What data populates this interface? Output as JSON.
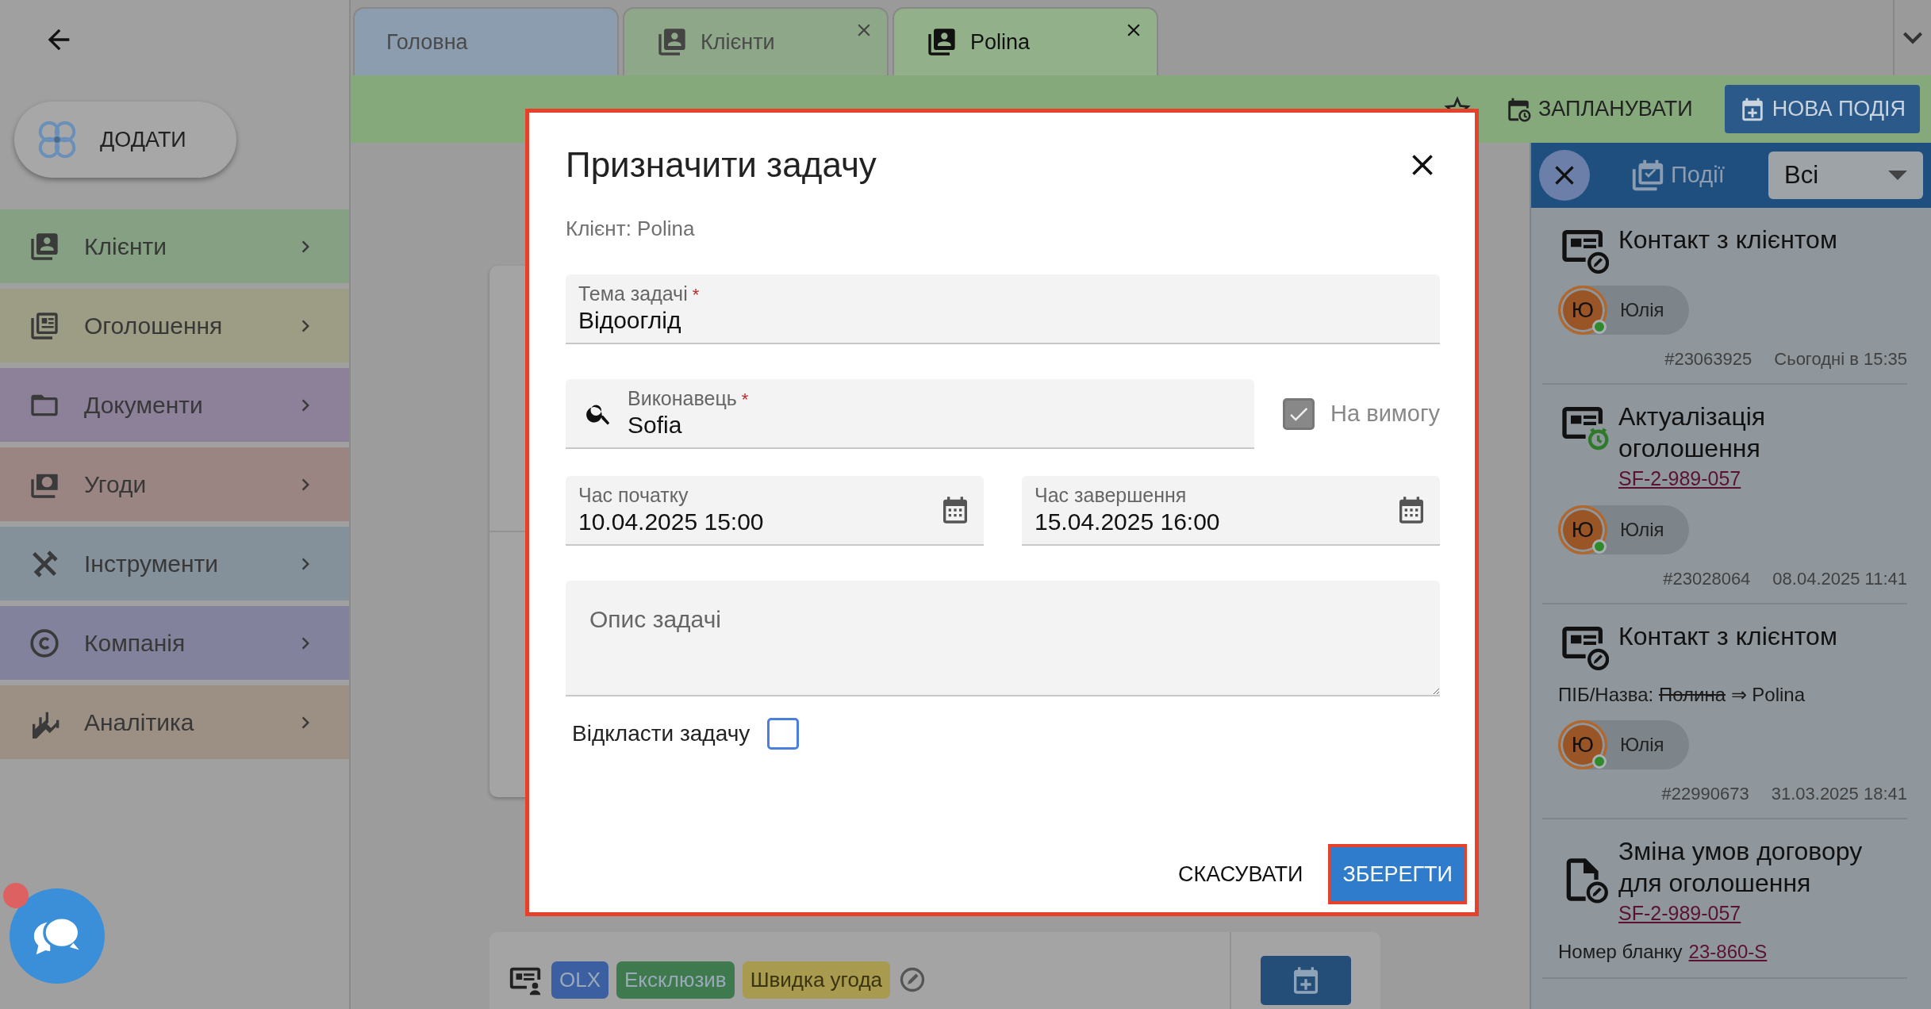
{
  "add_button": {
    "label": "ДОДАТИ"
  },
  "sidebar": {
    "items": [
      {
        "label": "Клієнти",
        "color": "#86a083"
      },
      {
        "label": "Оголошення",
        "color": "#9d9d85"
      },
      {
        "label": "Документи",
        "color": "#8c8199"
      },
      {
        "label": "Угоди",
        "color": "#9a8582"
      },
      {
        "label": "Інструменти",
        "color": "#84919b"
      },
      {
        "label": "Компанія",
        "color": "#82829c"
      },
      {
        "label": "Аналітика",
        "color": "#9c8f84"
      }
    ]
  },
  "tabs": [
    {
      "label": "Головна",
      "selected": false,
      "closable": false
    },
    {
      "label": "Клієнти",
      "selected": false,
      "closable": true
    },
    {
      "label": "Polina",
      "selected": true,
      "closable": true
    }
  ],
  "toolbar": {
    "actions": [
      {
        "label": "ЗАПЛАНУВАТИ",
        "kind": "plain"
      },
      {
        "label": "НОВА ПОДІЯ",
        "kind": "primary"
      }
    ]
  },
  "background_card": {
    "tags": [
      {
        "label": "OLX",
        "color": "#3b5fa0"
      },
      {
        "label": "Ексклюзив",
        "color": "#3e7a4e"
      },
      {
        "label": "Швидка угода",
        "color": "#a89a4e"
      }
    ]
  },
  "events_panel": {
    "title": "Події",
    "filter": "Всі",
    "events": [
      {
        "kind": "contact",
        "title": "Контакт з клієнтом",
        "user": {
          "initial": "Ю",
          "name": "Юлія"
        },
        "id": "#23063925",
        "time": "Сьогодні в 15:35"
      },
      {
        "kind": "reminder",
        "title": "Актуалізація оголошення",
        "link": "SF-2-989-057",
        "user": {
          "initial": "Ю",
          "name": "Юлія"
        },
        "id": "#23028064",
        "time": "08.04.2025 11:41"
      },
      {
        "kind": "contact",
        "title": "Контакт з клієнтом",
        "change": {
          "field": "ПІБ/Назва:",
          "old": "Полина",
          "arrow": "⇒",
          "new": "Polina"
        },
        "user": {
          "initial": "Ю",
          "name": "Юлія"
        },
        "id": "#22990673",
        "time": "31.03.2025 18:41"
      },
      {
        "kind": "document",
        "title": "Зміна умов договору для оголошення",
        "link": "SF-2-989-057",
        "note": {
          "label": "Номер бланку",
          "link": "23-860-S"
        }
      }
    ]
  },
  "dialog": {
    "title": "Призначити задачу",
    "client": "Клієнт: Polina",
    "subject": {
      "label": "Тема задачі",
      "mark": "*",
      "value": "Відооглід"
    },
    "assignee": {
      "label": "Виконавець",
      "mark": "*",
      "value": "Sofia"
    },
    "on_demand": {
      "label": "На вимогу",
      "checked": true,
      "disabled": true
    },
    "start": {
      "label": "Час початку",
      "value": "10.04.2025 15:00"
    },
    "end": {
      "label": "Час завершення",
      "value": "15.04.2025 16:00"
    },
    "description": {
      "placeholder": "Опис задачі"
    },
    "postpone": {
      "label": "Відкласти задачу",
      "checked": false
    },
    "buttons": [
      {
        "label": "СКАСУВАТИ",
        "kind": "text"
      },
      {
        "label": "ЗБЕРЕГТИ",
        "kind": "primary"
      }
    ]
  }
}
